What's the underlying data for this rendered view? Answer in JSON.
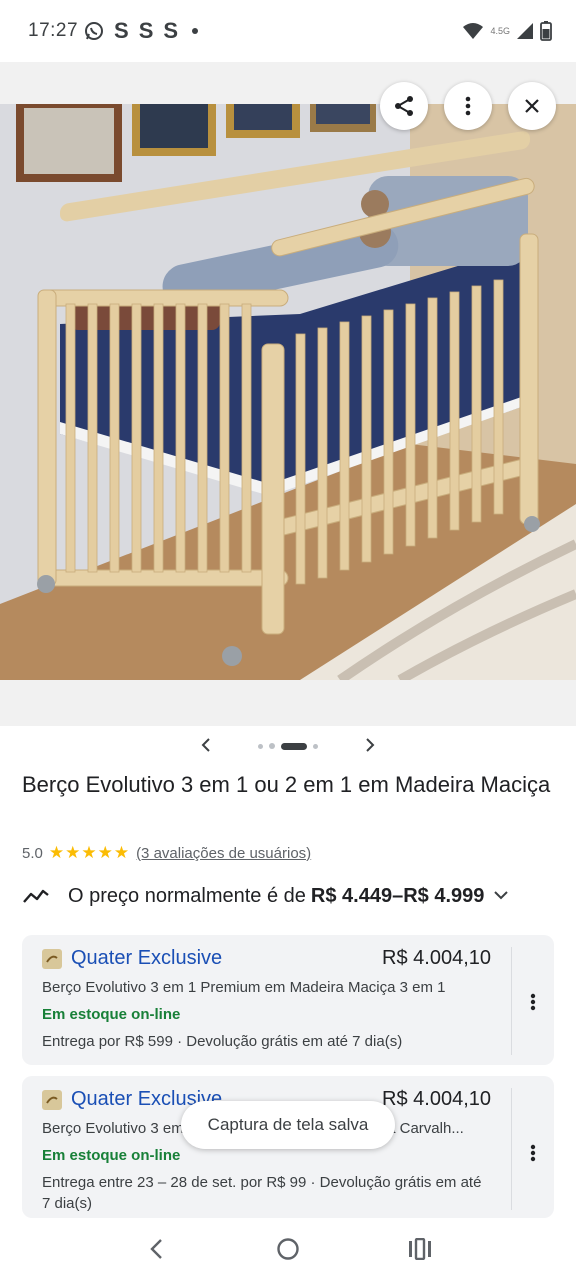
{
  "status_bar": {
    "time": "17:27",
    "notification_icons": [
      "whatsapp-icon",
      "S",
      "S",
      "S"
    ],
    "network_label": "4.5G"
  },
  "image_controls": {
    "share_icon": "share-icon",
    "more_icon": "more-vert-icon",
    "close_icon": "close-icon"
  },
  "carousel": {
    "prev_icon": "chevron-left-icon",
    "next_icon": "chevron-right-icon",
    "dot_count": 4,
    "active_index": 2
  },
  "product": {
    "title": "Berço Evolutivo 3 em 1 ou 2 em 1 em Madeira Maciça",
    "rating_value": "5.0",
    "stars": "★★★★★",
    "reviews_link": "(3 avaliações de usuários)"
  },
  "price_summary": {
    "prefix": "O preço normalmente é de",
    "range": "R$ 4.449–R$ 4.999",
    "expand_icon": "chevron-down-icon"
  },
  "offers": [
    {
      "merchant": "Quater Exclusive",
      "price": "R$ 4.004,10",
      "description": "Berço Evolutivo 3 em 1 Premium em Madeira Maciça 3 em 1",
      "stock": "Em estoque on-line",
      "shipping": "Entrega por R$ 599 · Devolução grátis em até 7 dia(s)"
    },
    {
      "merchant": "Quater Exclusive",
      "price": "R$ 4.004,10",
      "description": "Berço Evolutivo 3 em 1 Premium em Madeira Maciça Carvalh...",
      "stock": "Em estoque on-line",
      "shipping": "Entrega entre 23 – 28 de set. por R$ 99 · Devolução grátis em até 7 dia(s)"
    }
  ],
  "toast": {
    "message": "Captura de tela salva"
  },
  "nav_bar": {
    "back_icon": "back-icon",
    "home_icon": "home-icon",
    "recents_icon": "recents-icon"
  },
  "colors": {
    "link_blue": "#1a4fb5",
    "stock_green": "#188038",
    "star_yellow": "#fbbc04",
    "card_bg": "#f2f3f5"
  }
}
